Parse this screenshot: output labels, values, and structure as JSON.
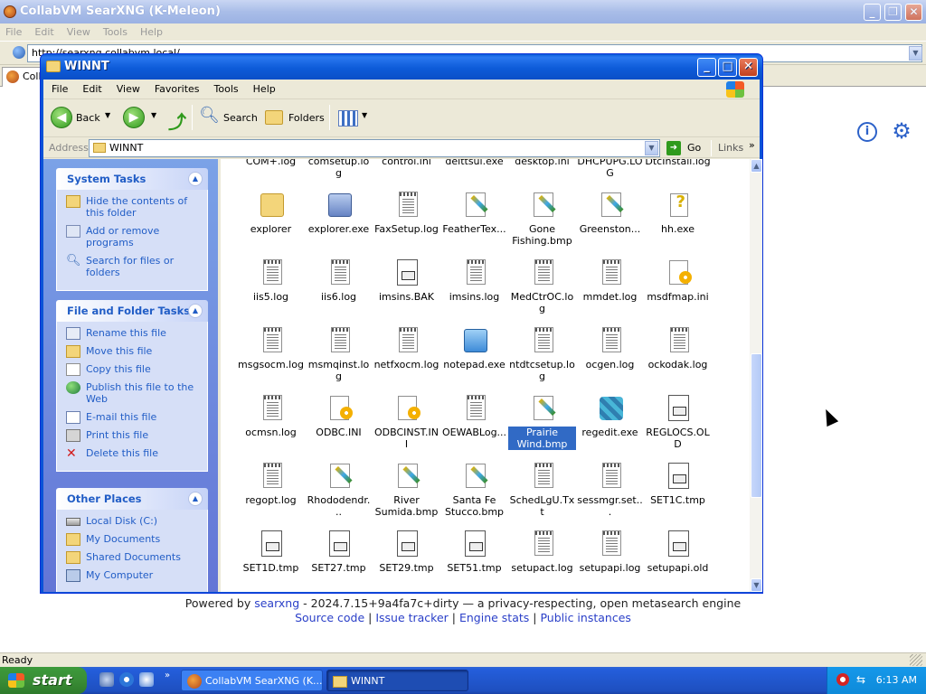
{
  "browser": {
    "title": "CollabVM SearXNG (K-Meleon)",
    "menu": [
      "File",
      "Edit",
      "View",
      "Tools",
      "Help"
    ],
    "url": "http://searxng.collabvm.local/",
    "tab_label": "Colla",
    "status": "Ready"
  },
  "searxng": {
    "footer_prefix": "Powered by ",
    "footer_brand": "searxng",
    "footer_rest": " - 2024.7.15+9a4fa7c+dirty — a privacy-respecting, open metasearch engine",
    "links": [
      "Source code",
      "Issue tracker",
      "Engine stats",
      "Public instances"
    ],
    "sep": " | "
  },
  "explorer": {
    "title": "WINNT",
    "menu": [
      "File",
      "Edit",
      "View",
      "Favorites",
      "Tools",
      "Help"
    ],
    "toolbar": {
      "back": "Back",
      "search": "Search",
      "folders": "Folders"
    },
    "address_label": "Address",
    "address_value": "WINNT",
    "go": "Go",
    "links": "Links",
    "system_tasks": {
      "title": "System Tasks",
      "items": [
        "Hide the contents of this folder",
        "Add or remove programs",
        "Search for files or folders"
      ]
    },
    "file_tasks": {
      "title": "File and Folder Tasks",
      "items": [
        "Rename this file",
        "Move this file",
        "Copy this file",
        "Publish this file to the Web",
        "E-mail this file",
        "Print this file",
        "Delete this file"
      ]
    },
    "other_places": {
      "title": "Other Places",
      "items": [
        "Local Disk (C:)",
        "My Documents",
        "Shared Documents",
        "My Computer"
      ]
    },
    "files": [
      {
        "name": "COM+.log",
        "type": "doc"
      },
      {
        "name": "comsetup.log",
        "type": "doc"
      },
      {
        "name": "control.ini",
        "type": "set"
      },
      {
        "name": "delttsul.exe",
        "type": "exe"
      },
      {
        "name": "desktop.ini",
        "type": "set"
      },
      {
        "name": "DHCPUPG.LOG",
        "type": "doc"
      },
      {
        "name": "DtcInstall.log",
        "type": "doc"
      },
      {
        "name": "explorer",
        "type": "folder-search"
      },
      {
        "name": "explorer.exe",
        "type": "computer"
      },
      {
        "name": "FaxSetup.log",
        "type": "doc"
      },
      {
        "name": "FeatherTex...",
        "type": "brush"
      },
      {
        "name": "Gone Fishing.bmp",
        "type": "brush"
      },
      {
        "name": "Greenston...",
        "type": "brush"
      },
      {
        "name": "hh.exe",
        "type": "help"
      },
      {
        "name": "iis5.log",
        "type": "doc"
      },
      {
        "name": "iis6.log",
        "type": "doc"
      },
      {
        "name": "imsins.BAK",
        "type": "bin"
      },
      {
        "name": "imsins.log",
        "type": "doc"
      },
      {
        "name": "MedCtrOC.log",
        "type": "doc"
      },
      {
        "name": "mmdet.log",
        "type": "doc"
      },
      {
        "name": "msdfmap.ini",
        "type": "set"
      },
      {
        "name": "msgsocm.log",
        "type": "doc"
      },
      {
        "name": "msmqinst.log",
        "type": "doc"
      },
      {
        "name": "netfxocm.log",
        "type": "doc"
      },
      {
        "name": "notepad.exe",
        "type": "notepad"
      },
      {
        "name": "ntdtcsetup.log",
        "type": "doc"
      },
      {
        "name": "ocgen.log",
        "type": "doc"
      },
      {
        "name": "ockodak.log",
        "type": "doc"
      },
      {
        "name": "ocmsn.log",
        "type": "doc"
      },
      {
        "name": "ODBC.INI",
        "type": "set"
      },
      {
        "name": "ODBCINST.INI",
        "type": "set"
      },
      {
        "name": "OEWABLog...",
        "type": "doc"
      },
      {
        "name": "Prairie Wind.bmp",
        "type": "brush",
        "selected": true
      },
      {
        "name": "regedit.exe",
        "type": "regedit"
      },
      {
        "name": "REGLOCS.OLD",
        "type": "bin"
      },
      {
        "name": "regopt.log",
        "type": "doc"
      },
      {
        "name": "Rhododendr...",
        "type": "brush"
      },
      {
        "name": "River Sumida.bmp",
        "type": "brush"
      },
      {
        "name": "Santa Fe Stucco.bmp",
        "type": "brush"
      },
      {
        "name": "SchedLgU.Txt",
        "type": "doc"
      },
      {
        "name": "sessmgr.set...",
        "type": "doc"
      },
      {
        "name": "SET1C.tmp",
        "type": "bin"
      },
      {
        "name": "SET1D.tmp",
        "type": "bin"
      },
      {
        "name": "SET27.tmp",
        "type": "bin"
      },
      {
        "name": "SET29.tmp",
        "type": "bin"
      },
      {
        "name": "SET51.tmp",
        "type": "bin"
      },
      {
        "name": "setupact.log",
        "type": "doc"
      },
      {
        "name": "setupapi.log",
        "type": "doc"
      },
      {
        "name": "setupapi.old",
        "type": "bin"
      }
    ]
  },
  "taskbar": {
    "start": "start",
    "items": [
      "CollabVM SearXNG (K...",
      "WINNT"
    ],
    "clock": "6:13 AM"
  }
}
